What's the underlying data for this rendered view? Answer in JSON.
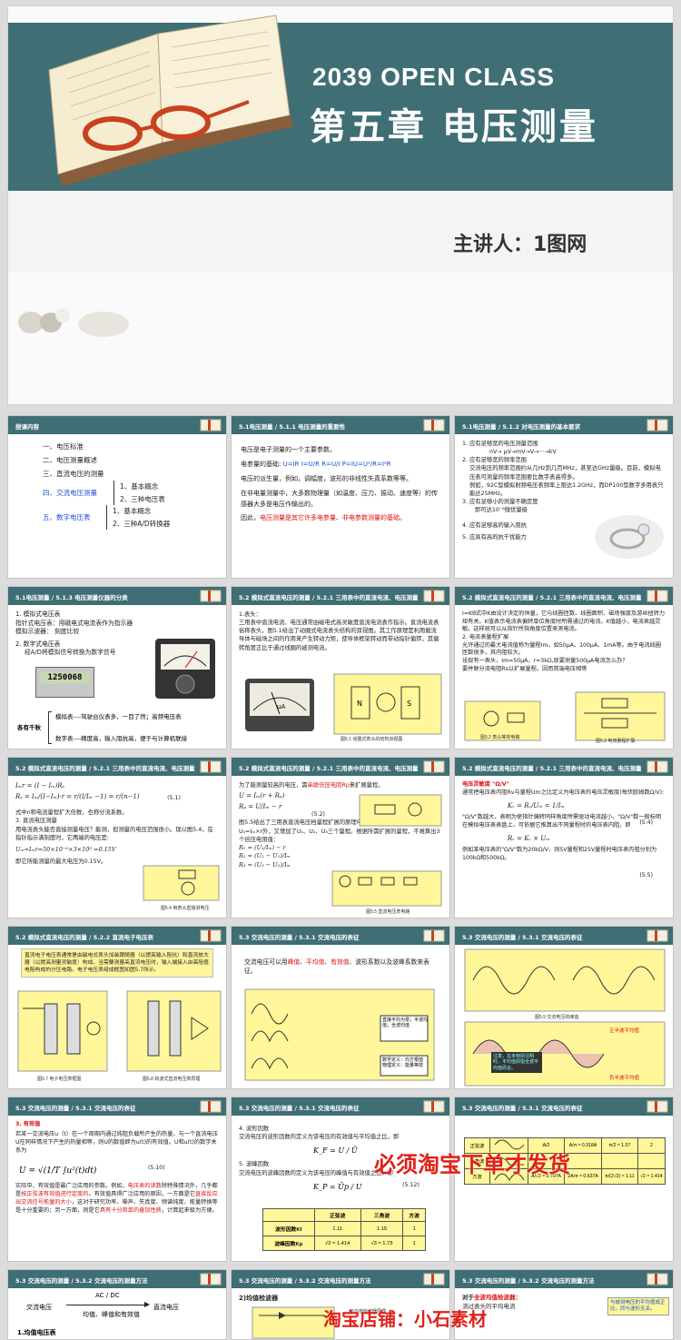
{
  "cover": {
    "en_title": "2039 OPEN CLASS",
    "cn_title": "第五章  电压测量",
    "speaker": "主讲人：1图网"
  },
  "slides": {
    "s1": {
      "header": "授课内容",
      "items": [
        "一、电压标准",
        "二、电压测量概述",
        "三、直流电压的测量",
        "四、交流电压测量",
        "五、数字电压表"
      ],
      "sub4": [
        "1、基本概念",
        "2、三种电压表"
      ],
      "sub5": [
        "1、基本概念",
        "2、三种A/D转换器"
      ]
    },
    "s2": {
      "header": "5.1电压测量 / 5.1.1  电压测量的重要性",
      "p1": "电压是电子测量的一个主要参数。",
      "p2a": "电参量的基础:",
      "p2b": "U=IR  I=U/R  R=U/I    P=IU=U²/R=I²R",
      "p3": "电压的派生量，例如，调幅度，波形的非线性失真系数等等。",
      "p4": "在非电量测量中，大多数物理量（如温度、压力、振动、速度等）的传感器大多是电压作输出的。",
      "p5a": "因此，",
      "p5b": "电压测量是其它许多电参量、非电参数测量的基础。"
    },
    "s3": {
      "header": "5.1电压测量 / 5.1.2  对电压测量的基本要求",
      "l1": "1. 应有足够宽的电压测量范围",
      "l1b": "nV→ μV→mV→V→···→kV",
      "l2": "2. 应有足够宽的频率范围",
      "l2b": "交流电压的频率范围约从几Hz到几百MHz，甚至达GHz量级。目前，模拟电压表可测量的频率范围要比数字表高得多。",
      "l2c": "例如，92C型模拟射频电压表频率上限达1.2GHz，而DP100型数字多用表只能达25MHz。",
      "l3": "3. 应有足够小的测量不确定度",
      "l3b": "即可达10⁻⁶微伏量级",
      "l4": "4. 应有足够高的输入阻抗",
      "l5": "5. 应具有高的抗干扰能力"
    },
    "s4": {
      "header": "5.1电压测量 / 5.1.3  电压测量仪器的分类",
      "l1": "1. 模拟式电压表",
      "l1b": "指针式电压表：用磁电式电流表作为指示器",
      "l1c": "模拟示波器：  刻度比较",
      "l2": "2. 数字式电压表",
      "l2b": "经A/D将模拟信号转换为数字信号",
      "lcd": "1250068",
      "brace": "各有千秋",
      "m1": "模拟表----驾驶台仪表多，一目了然；高频电压表",
      "m2": "数字表----精度高，输入阻抗高，便于与计算机联接"
    },
    "s5": {
      "header": "5.2 模拟式直流电压的测量 / 5.2.1 三用表中的直流电流、电压测量",
      "p1": "1.表头：",
      "p2": "三用表中直流电流、电压通常由磁电式高灵敏度直流电流表作指示。直流电流表俗称表头，图5.1给出了动圈式电流表头结构的双视图。其工作原理是利用载流导体与磁场之间的作用来产生转动力矩，使导体框架转动而带动指针偏转，其偏转角度正比于通过线圈的被测电流。",
      "cap": "图5.1 动圈式表头的结构双视图"
    },
    "s6": {
      "header": "5.2 模拟式直流电压的测量 / 5.2.1 三用表中的直流电流、电压测量",
      "p1": "I=Kθ式中K由设计决定的恒量，它与线圈匝数、线圈面积、磁场强度及游丝扭转力矩有关。K值表示电流表偏转单位角度时所需通过的电流，K值越小，电流表越灵敏。这样就可以从指针所指角度位置来测电流。",
      "p2": "2. 电流表量程扩展",
      "p3": "允许通过的最大电流值称为量程Im。如50μA、100μA、1mA等。由于电流线圈匝数很多，其内阻较大。",
      "p4": "设现有一表头，Im=50μA，r=3kΩ,现要测量500μA电流怎么办？",
      "p5": "要并联分流电阻Rs以扩展量程。因而简端电压相等",
      "cap1": "图5.2 表头等效电路",
      "cap2": "图5.3 电流量程扩展"
    },
    "s7": {
      "header": "5.2 模拟式直流电压的测量 / 5.2.1 三用表中的直流电流、电压测量",
      "f1": "Iₘr = (I − Iₘ)Rₛ",
      "f2": "Rₛ = Iₘ/(I−Iₘ)·r = r/(I/Iₘ −1) = r/(n−1)",
      "eq": "(5.1)",
      "p1": "式中n称电流量程扩大倍数，也称分流系数。",
      "p2": "3. 直流电压测量",
      "p3": "用电流表头能否直接测量电压？能测，但测量的电压范围很小。现以图5.4，在指针指示满刻度时，它两端的电压是:",
      "f3": "Uₘ=Iₘr=50×10⁻⁶×3×10³ =0.15V",
      "p4": "即它所能测量的最大电压为0.15V。",
      "cap": "图5.4 用表头直接测电压"
    },
    "s8": {
      "header": "5.2 模拟式直流电压的测量 / 5.2.1 三用表中的直流电流、电压测量",
      "p1a": "为了能测量较高的电压，需",
      "p1b": "串联倍压电阻Rp",
      "p1c": "来扩展量程。",
      "f1": "U = Iₘ(r + Rₚ)",
      "f2": "Rₚ = U/Iₘ − r",
      "eq": "(5.2)",
      "p2": "图5.5给出了三用表直流电压档量程扩展的原理电路图。图中除最小量程U₀=Iₘ×r外，又增加了U₁、U₂、U₃三个量程。根据所需扩展的量程，不难算出3个倍压电阻值：",
      "f3": "R₁ = (U₁/Iₘ) − r",
      "f4": "R₂ = (U₂ − U₁)/Iₘ",
      "f5": "R₃ = (U₃ − U₂)/Iₘ",
      "cap": "图5.5 直流电压表电路"
    },
    "s9": {
      "header": "5.2 模拟式直流电压的测量 / 5.2.1 三用表中的直流电流、电压测量",
      "p1": "电压灵敏度  \"Ω/V\"",
      "p2": "通常把电压表内阻Rv与量程Um之比定义为电压表的电压灵敏度(每伏欧姆数Ω/V):",
      "f1": "Kᵥ = Rᵥ/Uₘ = 1/Iₘ",
      "eq1": "(5.4)",
      "p3": "\"Ω/V\"数越大，表明为使指针偏转同样角度所需驱动电流越小。\"Ω/V\"数一般标明在模拟电压表表盘上，可依据它推算出不同量程时的电压表内阻，即",
      "f2": "Rᵥ = Kᵥ × Uₘ",
      "eq2": "(5.5)",
      "p4": "例如某电压表的\"Ω/V\"数为20kΩ/V，则5V量程和25V量程时电压表内阻分别为100kΩ和500kΩ。"
    },
    "s10": {
      "header": "5.2 模拟式直流电压的测量 / 5.2.2 直流电子电压表",
      "p1": "直流电子电压表通常是由磁电式表头加装跟随器（以提高输入阻抗）和直流放大器（以提高测量灵敏度）构成。当需要测量高直流电压时，输入端接入由高阻值电阻构成的分压电路。电子电压表组成框图如图5.7所示。",
      "cap1": "图5.7 电子电压表框图",
      "cap2": "图5.8 斩波式直流电压表原理"
    },
    "s11": {
      "header": "5.3 交流电压的测量 / 5.3.1 交流电压的表征",
      "p1a": "交流电压可以用",
      "p1b": "峰值",
      "p1c": "、",
      "p1d": "平均值",
      "p1e": "、",
      "p1f": "有效值",
      "p1g": "、波形系数以及波峰系数来表征。",
      "n1": "直接平均为零；半波均值；全波均值",
      "n2": "数学定义：均方根值  物理定义：能量等效"
    },
    "s12": {
      "header": "5.3 交流电压的测量 / 5.3.1 交流电压的表征",
      "cap": "图5.9 交流电压的峰值",
      "n1": "正半波平均值",
      "n2": "负半波平均值",
      "n3": "注意，在未特别注明时，平均值即指全波平均值而言。"
    },
    "s13": {
      "header": "5.3 交流电压的测量 / 5.3.1 交流电压的表征",
      "t1": "3. 有效值",
      "p1": "若某一交流电压u（t）在一个周期内通过纯阻负载所产生的热量，与一个直流电压U在同样情况下产生的热量相等，则U的数值即为u(t)的有效值。U和u(t)的数学关系为",
      "eq": "(5.10)",
      "p2a": "实际中，有效值是最广泛应用的参数。例如，",
      "p2b": "电压表的读数",
      "p2c": "除特殊情况外，几乎都是",
      "p2d": "按正弦波有效值进行定度的",
      "p2e": "。有效值具得广泛应用的原因，一方面是它",
      "p2f": "直接反应出交流信号能量的大小",
      "p2g": "，这对于研究功率、噪声、失真度、频谱纯度、能量转换等是十分重要的；另一方面，则是它",
      "p2h": "具有十分简单的叠加性质",
      "p2i": "，计算起来极为方便。"
    },
    "s14": {
      "header": "5.3 交流电压的测量 / 5.3.1 交流电压的表征",
      "p1": "4. 波形因数",
      "p2": "交流电压的波形因数的定义为该电压的有效值与平均值之比，即",
      "p3": "5. 波峰因数",
      "p4": "交流电压的波峰因数的定义为该电压的峰值与有效值之比，即",
      "eq": "(5.12)",
      "cols": [
        "",
        "正弦波",
        "三角波",
        "方波"
      ],
      "rows": [
        [
          "波形因数Kf",
          "1.11",
          "1.15",
          "1"
        ],
        [
          "波峰因数Kp",
          "√2 ≈ 1.414",
          "√3 ≈ 1.73",
          "1"
        ]
      ]
    },
    "s15": {
      "header": "5.3 交流电压的测量 / 5.3.1 交流电压的表征",
      "rows": [
        "正弦波",
        "三角波",
        "方波"
      ],
      "r1": [
        "A/2",
        "A/π ≈ 0.318A",
        "π/2 ≈ 1.57",
        "2"
      ],
      "r2": [
        "A/√2 ≈ 0.707A",
        "2A/π ≈ 0.637A",
        "π/(2√2) ≈ 1.11",
        "√2 ≈ 1.414"
      ]
    },
    "s16": {
      "header": "5.3 交流电压的测量 / 5.3.2 交流电压的测量方法",
      "top": "AC / DC",
      "left": "交流电压",
      "right": "直流电压",
      "bottom": "均值、峰值和有效值",
      "l1": "1.均值电压表"
    },
    "s17": {
      "header": "5.3 交流电压的测量 / 5.3.2 交流电压的测量方法",
      "l1": "2)均值检波器",
      "cap": "平均值检波器原理"
    },
    "s18": {
      "header": "5.3 交流电压的测量 / 5.3.2 交流电压的测量方法",
      "p1a": "对于",
      "p1b": "全波均值检波器",
      "p1c": "：",
      "p2": "流过表头的平均电流",
      "n1": "与被测电压的平均值成正比，同与波形无关。"
    }
  },
  "watermarks": {
    "w1": "必须淘宝下单才发货",
    "w2": "淘宝店铺：小石素材"
  }
}
